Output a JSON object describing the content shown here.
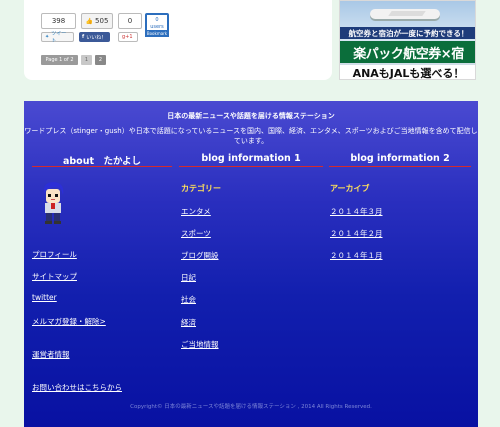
{
  "share": {
    "count1": "398",
    "like_count": "505",
    "count3": "0",
    "hatena_count": "0",
    "hatena_users": "users",
    "hatena_label": "Bookmark",
    "tweet_label": "ツイート",
    "fb_label": "いいね！",
    "gplus_label": "g+1"
  },
  "pager": {
    "status": "Page 1 of 2",
    "pages": [
      "1",
      "2"
    ]
  },
  "ad": {
    "line1": "航空券と宿泊が一度に予約できる！",
    "line2": "楽パック航空券×宿",
    "line3": "ANAもJALも選べる！"
  },
  "footer": {
    "title": "日本の最新ニュースや話題を届ける情報ステーション",
    "description": "ワードプレス（stinger・gush）や日本で話題になっているニュースを国内、国際、経済、エンタメ、スポーツおよびご当地情報を含めて配信しています。",
    "columns": [
      {
        "heading": "about　たかよし",
        "links": [
          "プロフィール",
          "サイトマップ",
          "twitter",
          "メルマガ登録・解除>",
          "運営者情報",
          "お問い合わせはこちらから"
        ]
      },
      {
        "heading": "blog information 1",
        "subheading": "カテゴリー",
        "links": [
          "エンタメ",
          "スポーツ",
          "ブログ開設",
          "日記",
          "社会",
          "経済",
          "ご当地情報"
        ]
      },
      {
        "heading": "blog information 2",
        "subheading": "アーカイブ",
        "links": [
          "２０１４年３月",
          "２０１４年２月",
          "２０１４年１月"
        ]
      }
    ],
    "copyright": "Copyright© 日本の最新ニュースや話題を届ける情報ステーション , 2014 All Rights Reserved."
  },
  "colors": {
    "footer_top": "#4a4ad1",
    "footer_bottom": "#0811a2",
    "accent_line": "#d52b2b",
    "subheading": "#ffe15a",
    "page_bg": "#e9f6ec"
  }
}
